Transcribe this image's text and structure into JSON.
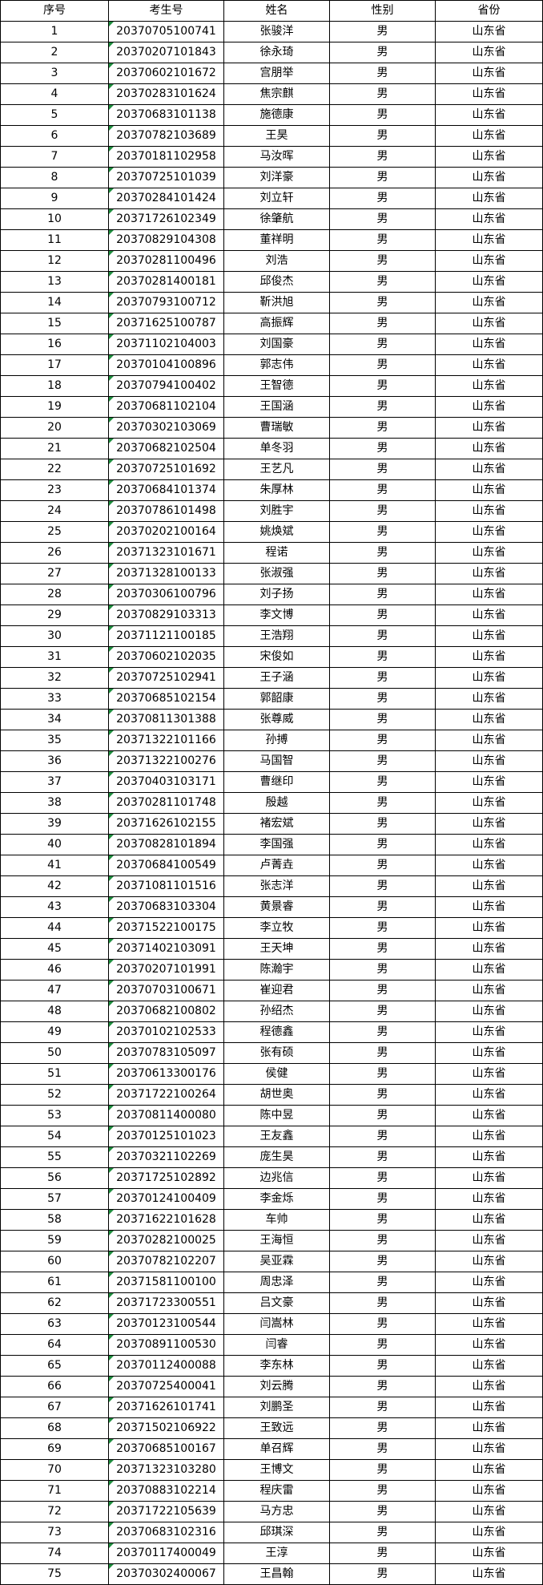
{
  "header": [
    "序号",
    "考生号",
    "姓名",
    "性别",
    "省份"
  ],
  "rows": [
    [
      "1",
      "20370705100741",
      "张骏洋",
      "男",
      "山东省"
    ],
    [
      "2",
      "20370207101843",
      "徐永琦",
      "男",
      "山东省"
    ],
    [
      "3",
      "20370602101672",
      "宫朋举",
      "男",
      "山东省"
    ],
    [
      "4",
      "20370283101624",
      "焦宗麒",
      "男",
      "山东省"
    ],
    [
      "5",
      "20370683101138",
      "施德康",
      "男",
      "山东省"
    ],
    [
      "6",
      "20370782103689",
      "王昊",
      "男",
      "山东省"
    ],
    [
      "7",
      "20370181102958",
      "马汝晖",
      "男",
      "山东省"
    ],
    [
      "8",
      "20370725101039",
      "刘洋豪",
      "男",
      "山东省"
    ],
    [
      "9",
      "20370284101424",
      "刘立轩",
      "男",
      "山东省"
    ],
    [
      "10",
      "20371726102349",
      "徐肇航",
      "男",
      "山东省"
    ],
    [
      "11",
      "20370829104308",
      "董祥明",
      "男",
      "山东省"
    ],
    [
      "12",
      "20370281100496",
      "刘浩",
      "男",
      "山东省"
    ],
    [
      "13",
      "20370281400181",
      "邱俊杰",
      "男",
      "山东省"
    ],
    [
      "14",
      "20370793100712",
      "靳洪旭",
      "男",
      "山东省"
    ],
    [
      "15",
      "20371625100787",
      "高振辉",
      "男",
      "山东省"
    ],
    [
      "16",
      "20371102104003",
      "刘国豪",
      "男",
      "山东省"
    ],
    [
      "17",
      "20370104100896",
      "郭志伟",
      "男",
      "山东省"
    ],
    [
      "18",
      "20370794100402",
      "王智德",
      "男",
      "山东省"
    ],
    [
      "19",
      "20370681102104",
      "王国涵",
      "男",
      "山东省"
    ],
    [
      "20",
      "20370302103069",
      "曹瑞敏",
      "男",
      "山东省"
    ],
    [
      "21",
      "20370682102504",
      "单冬羽",
      "男",
      "山东省"
    ],
    [
      "22",
      "20370725101692",
      "王艺凡",
      "男",
      "山东省"
    ],
    [
      "23",
      "20370684101374",
      "朱厚林",
      "男",
      "山东省"
    ],
    [
      "24",
      "20370786101498",
      "刘胜宇",
      "男",
      "山东省"
    ],
    [
      "25",
      "20370202100164",
      "姚焕斌",
      "男",
      "山东省"
    ],
    [
      "26",
      "20371323101671",
      "程诺",
      "男",
      "山东省"
    ],
    [
      "27",
      "20371328100133",
      "张淑强",
      "男",
      "山东省"
    ],
    [
      "28",
      "20370306100796",
      "刘子扬",
      "男",
      "山东省"
    ],
    [
      "29",
      "20370829103313",
      "李文博",
      "男",
      "山东省"
    ],
    [
      "30",
      "20371121100185",
      "王浩翔",
      "男",
      "山东省"
    ],
    [
      "31",
      "20370602102035",
      "宋俊如",
      "男",
      "山东省"
    ],
    [
      "32",
      "20370725102941",
      "王子涵",
      "男",
      "山东省"
    ],
    [
      "33",
      "20370685102154",
      "郭韶康",
      "男",
      "山东省"
    ],
    [
      "34",
      "20370811301388",
      "张尊威",
      "男",
      "山东省"
    ],
    [
      "35",
      "20371322101166",
      "孙搏",
      "男",
      "山东省"
    ],
    [
      "36",
      "20371322100276",
      "马国智",
      "男",
      "山东省"
    ],
    [
      "37",
      "20370403103171",
      "曹继印",
      "男",
      "山东省"
    ],
    [
      "38",
      "20370281101748",
      "殷越",
      "男",
      "山东省"
    ],
    [
      "39",
      "20371626102155",
      "褚宏斌",
      "男",
      "山东省"
    ],
    [
      "40",
      "20370828101894",
      "李国强",
      "男",
      "山东省"
    ],
    [
      "41",
      "20370684100549",
      "卢菁垚",
      "男",
      "山东省"
    ],
    [
      "42",
      "20371081101516",
      "张志洋",
      "男",
      "山东省"
    ],
    [
      "43",
      "20370683103304",
      "黄景睿",
      "男",
      "山东省"
    ],
    [
      "44",
      "20371522100175",
      "李立牧",
      "男",
      "山东省"
    ],
    [
      "45",
      "20371402103091",
      "王天坤",
      "男",
      "山东省"
    ],
    [
      "46",
      "20370207101991",
      "陈瀚宇",
      "男",
      "山东省"
    ],
    [
      "47",
      "20370703100671",
      "崔迎君",
      "男",
      "山东省"
    ],
    [
      "48",
      "20370682100802",
      "孙绍杰",
      "男",
      "山东省"
    ],
    [
      "49",
      "20370102102533",
      "程德鑫",
      "男",
      "山东省"
    ],
    [
      "50",
      "20370783105097",
      "张有硕",
      "男",
      "山东省"
    ],
    [
      "51",
      "20370613300176",
      "侯健",
      "男",
      "山东省"
    ],
    [
      "52",
      "20371722100264",
      "胡世奥",
      "男",
      "山东省"
    ],
    [
      "53",
      "20370811400080",
      "陈中昱",
      "男",
      "山东省"
    ],
    [
      "54",
      "20370125101023",
      "王友鑫",
      "男",
      "山东省"
    ],
    [
      "55",
      "20370321102269",
      "庞生昊",
      "男",
      "山东省"
    ],
    [
      "56",
      "20371725102892",
      "边兆信",
      "男",
      "山东省"
    ],
    [
      "57",
      "20370124100409",
      "李金烁",
      "男",
      "山东省"
    ],
    [
      "58",
      "20371622101628",
      "车帅",
      "男",
      "山东省"
    ],
    [
      "59",
      "20370282100025",
      "王海恒",
      "男",
      "山东省"
    ],
    [
      "60",
      "20370782102207",
      "吴亚霖",
      "男",
      "山东省"
    ],
    [
      "61",
      "20371581100100",
      "周忠泽",
      "男",
      "山东省"
    ],
    [
      "62",
      "20371723300551",
      "吕文豪",
      "男",
      "山东省"
    ],
    [
      "63",
      "20370123100544",
      "闫嵩林",
      "男",
      "山东省"
    ],
    [
      "64",
      "20370891100530",
      "闫睿",
      "男",
      "山东省"
    ],
    [
      "65",
      "20370112400088",
      "李东林",
      "男",
      "山东省"
    ],
    [
      "66",
      "20370725400041",
      "刘云腾",
      "男",
      "山东省"
    ],
    [
      "67",
      "20371626101741",
      "刘鹏圣",
      "男",
      "山东省"
    ],
    [
      "68",
      "20371502106922",
      "王致远",
      "男",
      "山东省"
    ],
    [
      "69",
      "20370685100167",
      "单召辉",
      "男",
      "山东省"
    ],
    [
      "70",
      "20371323103280",
      "王博文",
      "男",
      "山东省"
    ],
    [
      "71",
      "20370883102214",
      "程庆雷",
      "男",
      "山东省"
    ],
    [
      "72",
      "20371722105639",
      "马方忠",
      "男",
      "山东省"
    ],
    [
      "73",
      "20370683102316",
      "邱琪深",
      "男",
      "山东省"
    ],
    [
      "74",
      "20370117400049",
      "王淳",
      "男",
      "山东省"
    ],
    [
      "75",
      "20370302400067",
      "王昌翰",
      "男",
      "山东省"
    ]
  ],
  "colors": {
    "grid": "#000000",
    "text_indicator": "#1e8e3e"
  }
}
